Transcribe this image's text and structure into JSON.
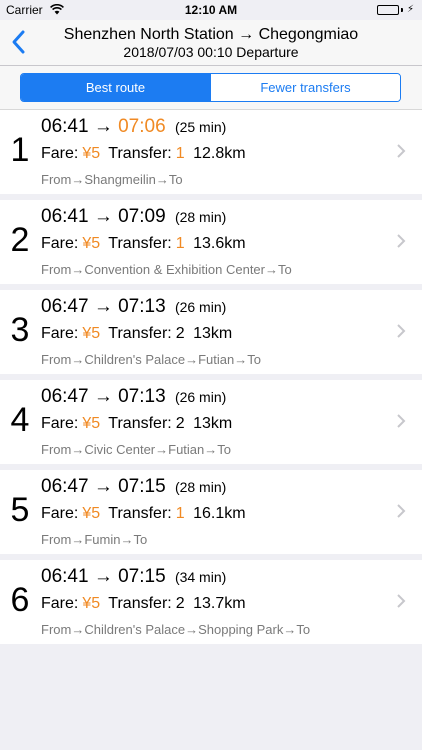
{
  "status": {
    "carrier": "Carrier",
    "time": "12:10 AM"
  },
  "nav": {
    "title": "Shenzhen North Station → Chegongmiao",
    "subtitle": "2018/07/03 00:10 Departure"
  },
  "segments": [
    {
      "label": "Best route",
      "active": true
    },
    {
      "label": "Fewer transfers",
      "active": false
    }
  ],
  "colors": {
    "accent": "#1c7cf2",
    "highlight": "#f08a24"
  },
  "routes": [
    {
      "index": "1",
      "depart": "06:41",
      "arrow": "→",
      "arrive": "07:06",
      "arrive_highlight": true,
      "duration": "(25 min)",
      "fare_label": "Fare:",
      "fare": "¥5",
      "transfer_label": "Transfer:",
      "transfer": "1",
      "transfer_highlight": true,
      "distance": "12.8km",
      "path": "From→Shangmeilin→To"
    },
    {
      "index": "2",
      "depart": "06:41",
      "arrow": "→",
      "arrive": "07:09",
      "arrive_highlight": false,
      "duration": "(28 min)",
      "fare_label": "Fare:",
      "fare": "¥5",
      "transfer_label": "Transfer:",
      "transfer": "1",
      "transfer_highlight": true,
      "distance": "13.6km",
      "path": "From→Convention & Exhibition Center→To"
    },
    {
      "index": "3",
      "depart": "06:47",
      "arrow": "→",
      "arrive": "07:13",
      "arrive_highlight": false,
      "duration": "(26 min)",
      "fare_label": "Fare:",
      "fare": "¥5",
      "transfer_label": "Transfer:",
      "transfer": "2",
      "transfer_highlight": false,
      "distance": "13km",
      "path": "From→Children's Palace→Futian→To"
    },
    {
      "index": "4",
      "depart": "06:47",
      "arrow": "→",
      "arrive": "07:13",
      "arrive_highlight": false,
      "duration": "(26 min)",
      "fare_label": "Fare:",
      "fare": "¥5",
      "transfer_label": "Transfer:",
      "transfer": "2",
      "transfer_highlight": false,
      "distance": "13km",
      "path": "From→Civic Center→Futian→To"
    },
    {
      "index": "5",
      "depart": "06:47",
      "arrow": "→",
      "arrive": "07:15",
      "arrive_highlight": false,
      "duration": "(28 min)",
      "fare_label": "Fare:",
      "fare": "¥5",
      "transfer_label": "Transfer:",
      "transfer": "1",
      "transfer_highlight": true,
      "distance": "16.1km",
      "path": "From→Fumin→To"
    },
    {
      "index": "6",
      "depart": "06:41",
      "arrow": "→",
      "arrive": "07:15",
      "arrive_highlight": false,
      "duration": "(34 min)",
      "fare_label": "Fare:",
      "fare": "¥5",
      "transfer_label": "Transfer:",
      "transfer": "2",
      "transfer_highlight": false,
      "distance": "13.7km",
      "path": "From→Children's Palace→Shopping Park→To"
    }
  ]
}
